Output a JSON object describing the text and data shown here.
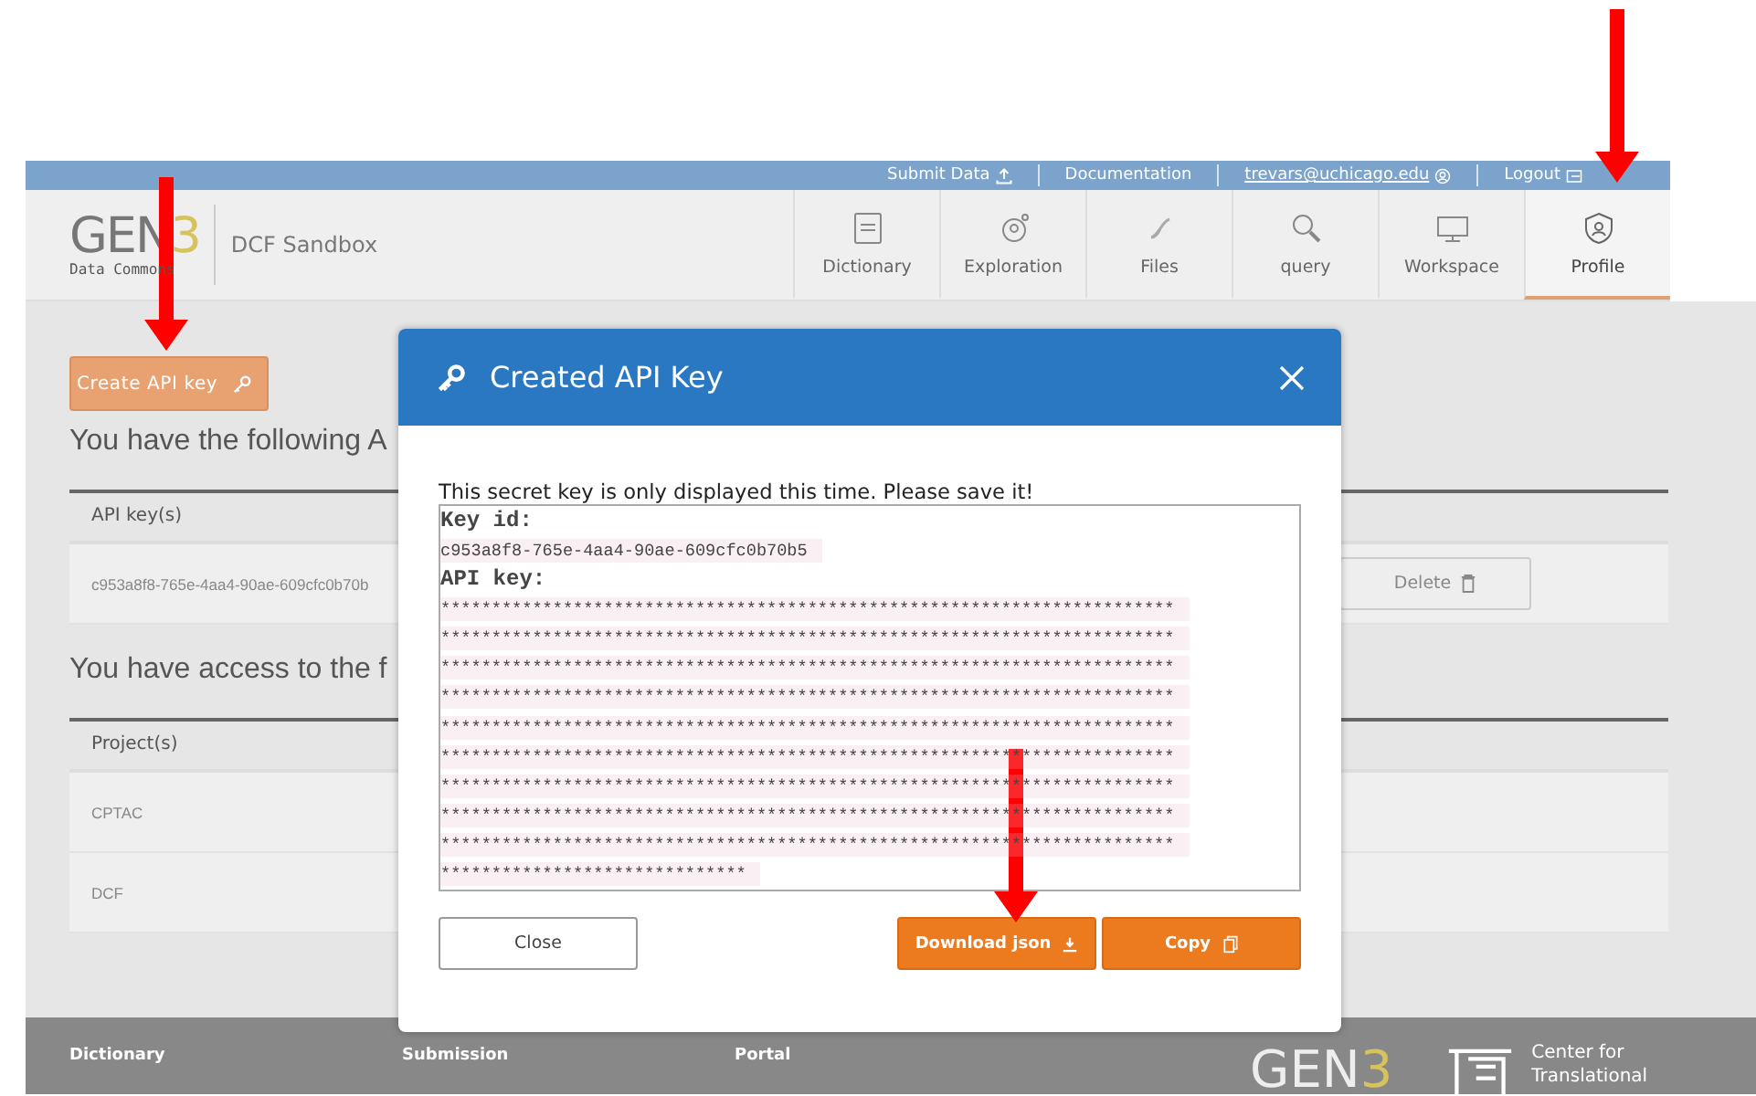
{
  "top_links": [
    {
      "label": "Submit Data",
      "kind": "upload"
    },
    {
      "label": "Documentation",
      "kind": "plain"
    },
    {
      "label": "trevars@uchicago.edu",
      "kind": "user"
    },
    {
      "label": "Logout",
      "kind": "logout"
    }
  ],
  "logo": {
    "wordmark": "GEN",
    "digit": "3",
    "subtitle": "Data Commons"
  },
  "site_name": "DCF Sandbox",
  "nav_tabs": [
    {
      "label": "Dictionary",
      "selected": false
    },
    {
      "label": "Exploration",
      "selected": false
    },
    {
      "label": "Files",
      "selected": false
    },
    {
      "label": "query",
      "selected": false
    },
    {
      "label": "Workspace",
      "selected": false
    },
    {
      "label": "Profile",
      "selected": true
    }
  ],
  "create_button": "Create API key",
  "keys_heading": "You have the following A",
  "keys_table": {
    "column": "API key(s)",
    "rows": [
      {
        "key": "c953a8f8-765e-4aa4-90ae-609cfc0b70b",
        "action": "Delete"
      }
    ]
  },
  "projects_heading": "You have access to the f",
  "projects_table": {
    "column": "Project(s)",
    "rows": [
      "CPTAC",
      "DCF"
    ]
  },
  "modal": {
    "title": "Created API Key",
    "message": "This secret key is only displayed this time. Please save it!",
    "key_id_label": "Key id:",
    "key_id": "c953a8f8-765e-4aa4-90ae-609cfc0b70b5",
    "api_key_label": "API key:",
    "api_key_lines": [
      "************************************************************************",
      "************************************************************************",
      "************************************************************************",
      "************************************************************************",
      "************************************************************************",
      "************************************************************************",
      "************************************************************************",
      "************************************************************************",
      "************************************************************************",
      "******************************"
    ],
    "buttons": [
      {
        "label": "Close",
        "kind": "secondary"
      },
      {
        "label": "Download json",
        "kind": "download"
      },
      {
        "label": "Copy",
        "kind": "copy"
      }
    ]
  },
  "footer": {
    "links": [
      "Dictionary",
      "Submission",
      "Portal"
    ],
    "logo_wordmark": "GEN",
    "logo_digit": "3",
    "partner": [
      "Center for",
      "Translational"
    ]
  }
}
